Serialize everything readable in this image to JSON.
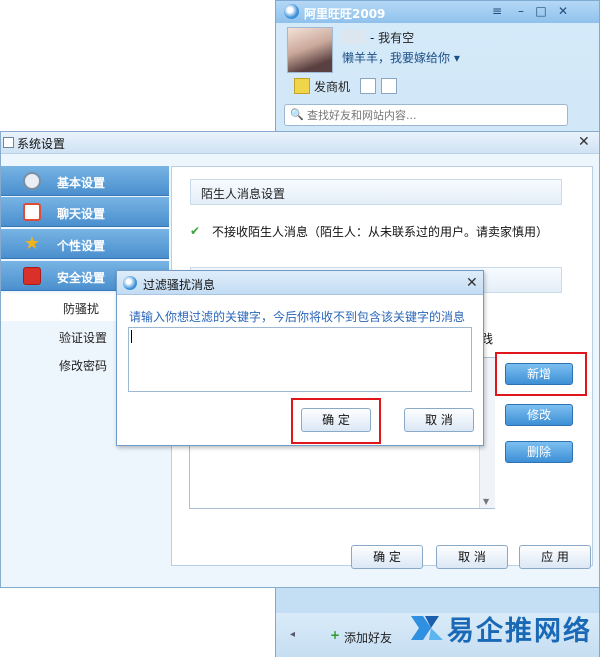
{
  "wangwang": {
    "title": "阿里旺旺2009",
    "controls": [
      "≡",
      "–",
      "□",
      "✕"
    ],
    "user_name": "- 我有空",
    "signature": "懒羊羊，我要嫁给你",
    "signature_arrow": "▾",
    "tool_label": "发商机",
    "search_placeholder": "查找好友和网站内容...",
    "add_friend": "添加好友"
  },
  "settings": {
    "title": "系统设置",
    "close": "✕",
    "categories": [
      {
        "label": "基本设置",
        "icon": "gear-icon",
        "color": "#7a8fa3"
      },
      {
        "label": "聊天设置",
        "icon": "calendar-icon",
        "color": "#e04b3a"
      },
      {
        "label": "个性设置",
        "icon": "star-icon",
        "color": "#f2b21b"
      },
      {
        "label": "安全设置",
        "icon": "shield-icon",
        "color": "#d9302a"
      }
    ],
    "sub_items": [
      "防骚扰",
      "验证设置",
      "修改密码"
    ],
    "selected_sub": "防骚扰",
    "section_title": "陌生人消息设置",
    "checkbox_label": "不接收陌生人消息（陌生人：从未联系过的用户。请卖家慎用）",
    "label_fragment": "践",
    "side_buttons": {
      "add": "新增",
      "modify": "修改",
      "delete": "删除"
    },
    "footer_buttons": {
      "ok": "确 定",
      "cancel": "取 消",
      "apply": "应 用"
    }
  },
  "filter_dialog": {
    "title": "过滤骚扰消息",
    "close": "✕",
    "prompt": "请输入你想过滤的关键字，今后你将收不到包含该关键字的消息",
    "input_value": "",
    "ok": "确 定",
    "cancel": "取 消"
  },
  "watermark": {
    "text": "易企推网络"
  },
  "colors": {
    "highlight_red": "#e0161b",
    "accent_blue": "#3d8fd6",
    "prompt_blue": "#2a66b8"
  }
}
